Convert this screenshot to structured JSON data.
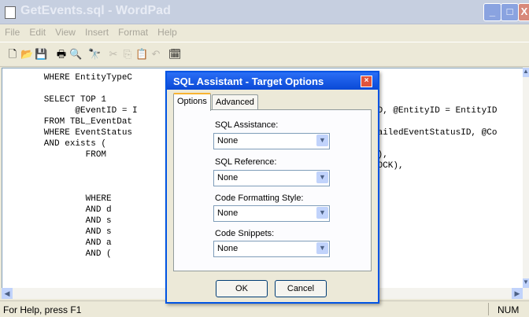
{
  "window": {
    "title": "GetEvents.sql - WordPad"
  },
  "menu": [
    "File",
    "Edit",
    "View",
    "Insert",
    "Format",
    "Help"
  ],
  "toolbar_icons": [
    "new-icon",
    "open-icon",
    "save-icon",
    "print-icon",
    "print-preview-icon",
    "find-icon",
    "cut-icon",
    "copy-icon",
    "paste-icon",
    "undo-icon",
    "datetime-icon"
  ],
  "code": [
    "        WHERE EntityTypeC",
    "",
    "        SELECT TOP 1",
    "              @EventID = I",
    "        FROM TBL_EventDat",
    "        WHERE EventStatus",
    "        AND exists (",
    "                FROM",
    "",
    "",
    "                WHERE",
    "                AND d",
    "                AND s",
    "                AND s",
    "                AND a",
    "                AND ("
  ],
  "code_right": [
    "",
    "",
    "",
    "ID, @EntityID = EntityID",
    "",
    "FailedEventStatusID, @Co",
    "",
    "K),",
    "LOCK),"
  ],
  "status": {
    "message": "For Help, press F1",
    "num": "NUM"
  },
  "dialog": {
    "title": "SQL Assistant - Target Options",
    "close": "×",
    "tabs": [
      "Options",
      "Advanced"
    ],
    "fields": [
      {
        "label": "SQL Assistance:",
        "value": "None"
      },
      {
        "label": "SQL Reference:",
        "value": "None"
      },
      {
        "label": "Code Formatting Style:",
        "value": "None"
      },
      {
        "label": "Code Snippets:",
        "value": "None"
      }
    ],
    "ok": "OK",
    "cancel": "Cancel"
  }
}
